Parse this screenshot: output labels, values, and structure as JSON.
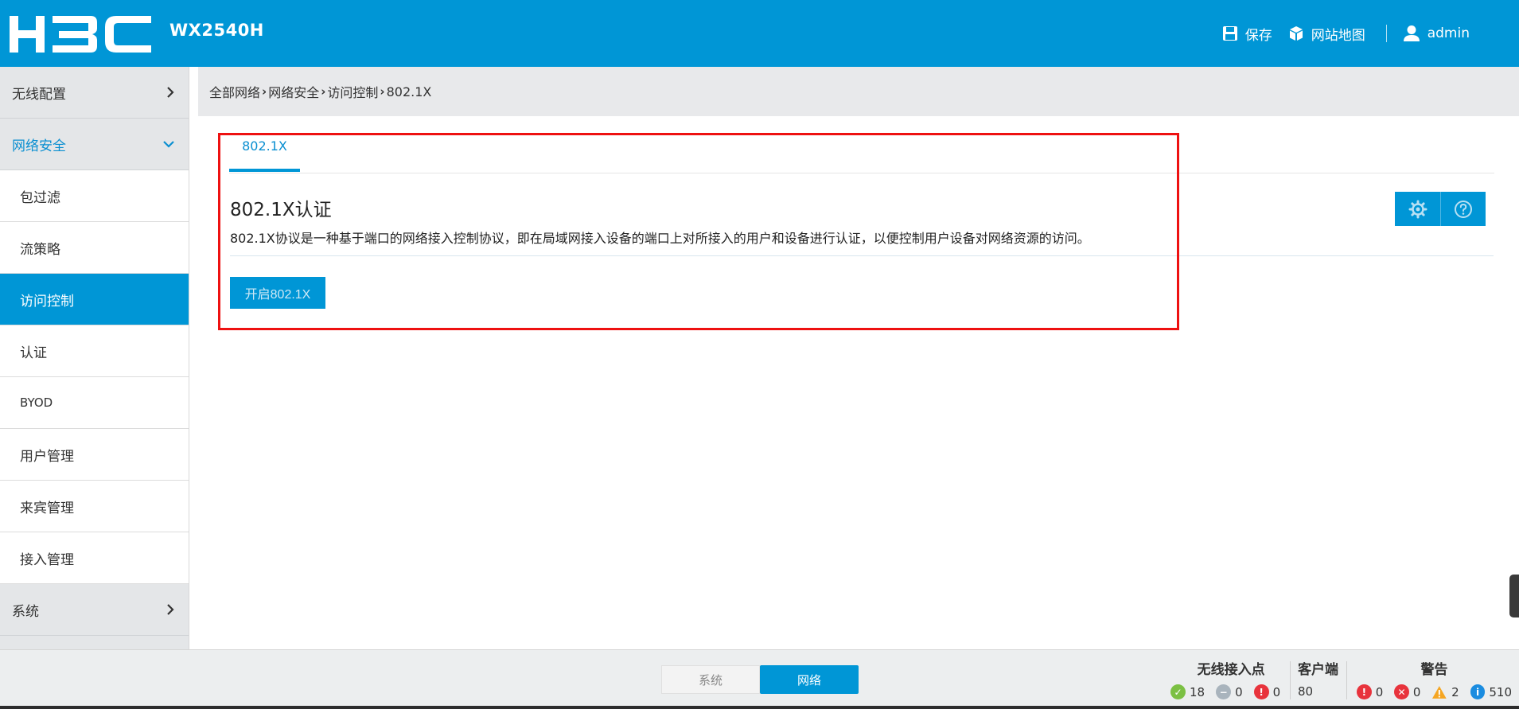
{
  "header": {
    "brand": "H3C",
    "model": "WX2540H",
    "save_label": "保存",
    "sitemap_label": "网站地图",
    "user_label": "admin",
    "bg_color": "#0096d6"
  },
  "sidebar": {
    "groups": [
      {
        "label": "无线配置",
        "icon": "chevron-right-icon"
      },
      {
        "label": "网络安全",
        "icon": "chevron-down-icon"
      },
      {
        "label": "系统",
        "icon": "chevron-right-icon"
      }
    ],
    "items": [
      {
        "label": "包过滤"
      },
      {
        "label": "流策略"
      },
      {
        "label": "访问控制"
      },
      {
        "label": "认证"
      },
      {
        "label": "BYOD"
      },
      {
        "label": "用户管理"
      },
      {
        "label": "来宾管理"
      },
      {
        "label": "接入管理"
      }
    ]
  },
  "breadcrumb": [
    "全部网络",
    "网络安全",
    "访问控制",
    "802.1X"
  ],
  "main": {
    "tab_label": "802.1X",
    "title": "802.1X认证",
    "description": "802.1X协议是一种基于端口的网络接入控制协议，即在局域网接入设备的端口上对所接入的用户和设备进行认证，以便控制用户设备对网络资源的访问。",
    "enable_button": "开启802.1X",
    "settings_icon": "gear-icon",
    "help_icon": "help-icon"
  },
  "footer": {
    "segment": {
      "system": "系统",
      "network": "网络"
    },
    "ap": {
      "title": "无线接入点",
      "online": "18",
      "offline": "0",
      "fault": "0"
    },
    "clients": {
      "title": "客户端",
      "count": "80"
    },
    "alerts": {
      "title": "警告",
      "critical": "0",
      "error": "0",
      "warning": "2",
      "info": "510"
    }
  }
}
